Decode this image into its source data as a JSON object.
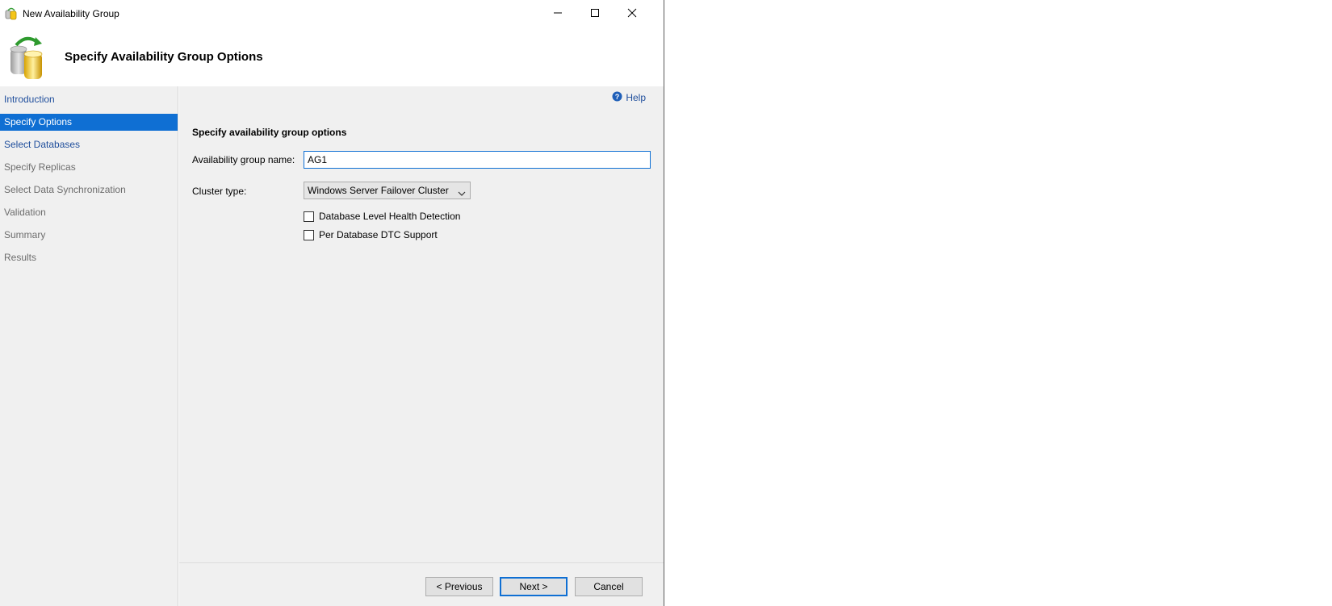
{
  "window": {
    "title": "New Availability Group"
  },
  "header": {
    "page_title": "Specify Availability Group Options"
  },
  "sidebar": {
    "items": [
      {
        "label": "Introduction",
        "state": "done"
      },
      {
        "label": "Specify Options",
        "state": "active"
      },
      {
        "label": "Select Databases",
        "state": "done"
      },
      {
        "label": "Specify Replicas",
        "state": "future"
      },
      {
        "label": "Select Data Synchronization",
        "state": "future"
      },
      {
        "label": "Validation",
        "state": "future"
      },
      {
        "label": "Summary",
        "state": "future"
      },
      {
        "label": "Results",
        "state": "future"
      }
    ]
  },
  "main": {
    "help_label": "Help",
    "section_title": "Specify availability group options",
    "ag_name_label": "Availability group name:",
    "ag_name_value": "AG1",
    "cluster_type_label": "Cluster type:",
    "cluster_type_value": "Windows Server Failover Cluster",
    "checkboxes": [
      {
        "label": "Database Level Health Detection",
        "checked": false
      },
      {
        "label": "Per Database DTC Support",
        "checked": false
      }
    ]
  },
  "footer": {
    "previous_label": "< Previous",
    "next_label": "Next >",
    "cancel_label": "Cancel"
  },
  "colors": {
    "accent": "#0f6fd3",
    "link": "#1f4e9c",
    "panel": "#f0f0f0"
  },
  "icons": {
    "app": "availability-group-icon",
    "help": "help-icon",
    "minimize": "minimize-icon",
    "maximize": "maximize-icon",
    "close": "close-icon",
    "dropdown": "chevron-down-icon"
  }
}
